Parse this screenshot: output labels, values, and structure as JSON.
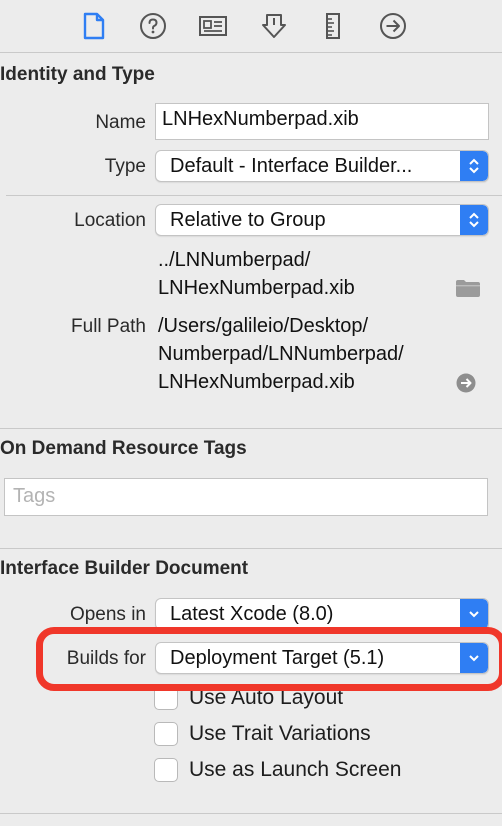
{
  "toolbar": {
    "icons": [
      "file-inspector-icon",
      "quick-help-icon",
      "identity-inspector-icon",
      "attributes-inspector-icon",
      "size-inspector-icon",
      "connections-inspector-icon"
    ]
  },
  "identity": {
    "title": "Identity and Type",
    "name_label": "Name",
    "name_value": "LNHexNumberpad.xib",
    "type_label": "Type",
    "type_value": "Default - Interface Builder...",
    "location_label": "Location",
    "location_value": "Relative to Group",
    "relative_path_line1": "../LNNumberpad/",
    "relative_path_line2": "LNHexNumberpad.xib",
    "full_path_label": "Full Path",
    "full_path_line1": "/Users/galileio/Desktop/",
    "full_path_line2": "Numberpad/LNNumberpad/",
    "full_path_line3": "LNHexNumberpad.xib"
  },
  "on_demand": {
    "title": "On Demand Resource Tags",
    "tags_placeholder": "Tags"
  },
  "ib_document": {
    "title": "Interface Builder Document",
    "opens_in_label": "Opens in",
    "opens_in_value": "Latest Xcode (8.0)",
    "builds_for_label": "Builds for",
    "builds_for_value": "Deployment Target (5.1)",
    "checkboxes": [
      {
        "label": "Use Auto Layout",
        "checked": false
      },
      {
        "label": "Use Trait Variations",
        "checked": false
      },
      {
        "label": "Use as Launch Screen",
        "checked": false
      }
    ]
  },
  "colors": {
    "accent": "#2f7ef3",
    "highlight": "#f0372a",
    "background": "#ececec"
  }
}
